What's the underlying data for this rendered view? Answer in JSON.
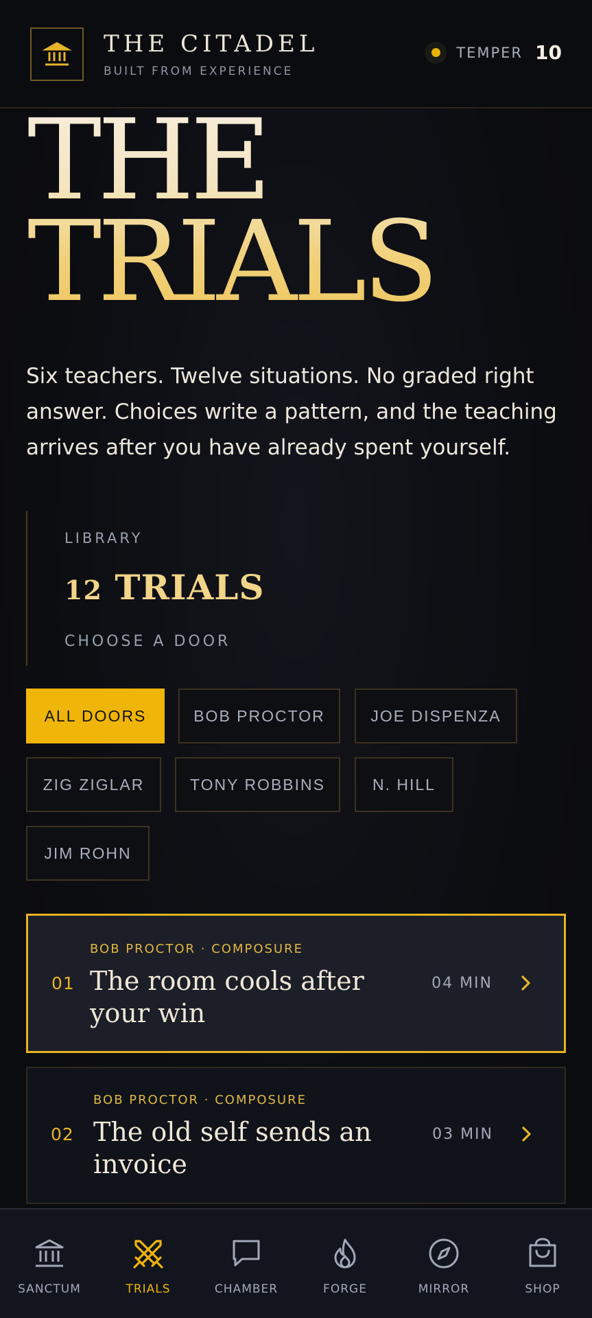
{
  "header": {
    "brand_title": "THE CITADEL",
    "brand_subtitle": "BUILT FROM EXPERIENCE",
    "temper_label": "TEMPER",
    "temper_value": "10"
  },
  "hero": {
    "title_line1": "THE",
    "title_line2": "TRIALS",
    "intro": "Six teachers. Twelve situations. No graded right answer. Choices write a pattern, and the teaching arrives after you have already spent yourself."
  },
  "library": {
    "label": "LIBRARY",
    "count_number": "12",
    "count_word": "TRIALS",
    "cta": "CHOOSE A DOOR"
  },
  "filters": [
    {
      "label": "ALL DOORS",
      "active": true
    },
    {
      "label": "BOB PROCTOR",
      "active": false
    },
    {
      "label": "JOE DISPENZA",
      "active": false
    },
    {
      "label": "ZIG ZIGLAR",
      "active": false
    },
    {
      "label": "TONY ROBBINS",
      "active": false
    },
    {
      "label": "N. HILL",
      "active": false
    },
    {
      "label": "JIM ROHN",
      "active": false
    }
  ],
  "trials": [
    {
      "number": "01",
      "meta": "BOB PROCTOR · COMPOSURE",
      "title": "The room cools after your win",
      "duration": "04 MIN",
      "icon": "chevron-right-icon"
    },
    {
      "number": "02",
      "meta": "BOB PROCTOR · COMPOSURE",
      "title": "The old self sends an invoice",
      "duration": "03 MIN",
      "icon": "chevron-right-icon"
    }
  ],
  "nav": [
    {
      "label": "SANCTUM",
      "icon": "temple-icon",
      "active": false
    },
    {
      "label": "TRIALS",
      "icon": "crossed-swords-icon",
      "active": true
    },
    {
      "label": "CHAMBER",
      "icon": "chat-bubble-icon",
      "active": false
    },
    {
      "label": "FORGE",
      "icon": "flame-icon",
      "active": false
    },
    {
      "label": "MIRROR",
      "icon": "compass-icon",
      "active": false
    },
    {
      "label": "SHOP",
      "icon": "shopping-bag-icon",
      "active": false
    }
  ],
  "colors": {
    "accent": "#efb509",
    "background": "#0b0c0f",
    "gold_text": "#f3d58a"
  }
}
